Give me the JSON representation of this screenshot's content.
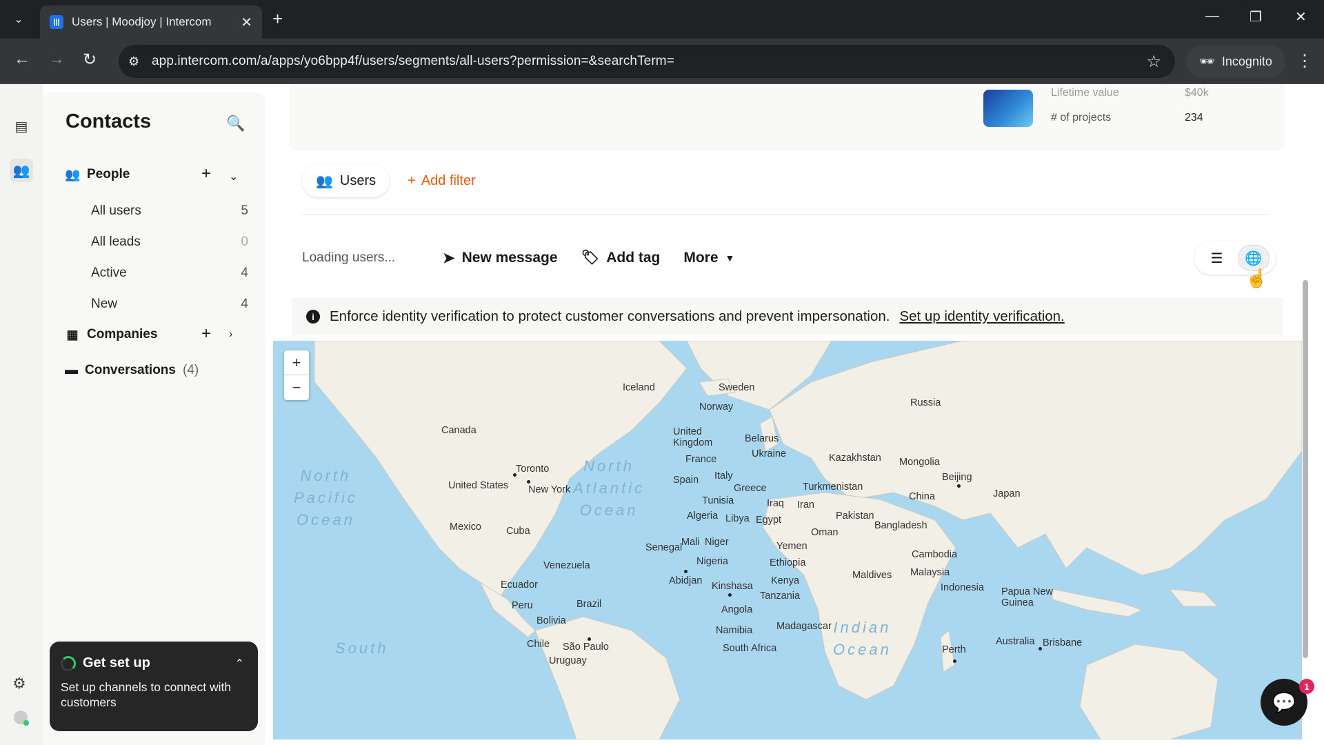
{
  "browser": {
    "tab_title": "Users | Moodjoy | Intercom",
    "url": "app.intercom.com/a/apps/yo6bpp4f/users/segments/all-users?permission=&searchTerm=",
    "incognito_label": "Incognito"
  },
  "sidebar": {
    "title": "Contacts",
    "people_label": "People",
    "items": [
      {
        "label": "All users",
        "count": "5"
      },
      {
        "label": "All leads",
        "count": "0"
      },
      {
        "label": "Active",
        "count": "4"
      },
      {
        "label": "New",
        "count": "4"
      }
    ],
    "companies_label": "Companies",
    "conversations_label": "Conversations",
    "conversations_count": "(4)"
  },
  "setup_card": {
    "title": "Get set up",
    "body": "Set up channels to connect with customers"
  },
  "top_card": {
    "lifetime_label": "Lifetime value",
    "lifetime_value": "$40k",
    "projects_label": "# of projects",
    "projects_value": "234"
  },
  "filters": {
    "users_pill": "Users",
    "add_filter": "Add filter"
  },
  "toolbar": {
    "loading": "Loading users...",
    "new_message": "New message",
    "add_tag": "Add tag",
    "more": "More"
  },
  "notice": {
    "text": "Enforce identity verification to protect customer conversations and prevent impersonation.",
    "link": "Set up identity verification."
  },
  "map": {
    "labels": {
      "iceland": "Iceland",
      "sweden": "Sweden",
      "norway": "Norway",
      "russia": "Russia",
      "canada": "Canada",
      "uk": "United\nKingdom",
      "belarus": "Belarus",
      "ukraine": "Ukraine",
      "kazakhstan": "Kazakhstan",
      "mongolia": "Mongolia",
      "toronto": "Toronto",
      "france": "France",
      "us": "United States",
      "newyork": "New York",
      "spain": "Spain",
      "italy": "Italy",
      "turkmenistan": "Turkmenistan",
      "beijing": "Beijing",
      "greece": "Greece",
      "china": "China",
      "japan": "Japan",
      "tunisia": "Tunisia",
      "iraq": "Iraq",
      "iran": "Iran",
      "pakistan": "Pakistan",
      "algeria": "Algeria",
      "libya": "Libya",
      "egypt": "Egypt",
      "bangladesh": "Bangladesh",
      "mexico": "Mexico",
      "cuba": "Cuba",
      "oman": "Oman",
      "mali": "Mali",
      "niger": "Niger",
      "senegal": "Senegal",
      "yemen": "Yemen",
      "cambodia": "Cambodia",
      "nigeria": "Nigeria",
      "ethiopia": "Ethiopia",
      "venezuela": "Venezuela",
      "malaysia": "Malaysia",
      "abidjan": "Abidjan",
      "maldives": "Maldives",
      "kenya": "Kenya",
      "indonesia": "Indonesia",
      "ecuador": "Ecuador",
      "kinshasa": "Kinshasa",
      "png": "Papua New\nGuinea",
      "tanzania": "Tanzania",
      "brazil": "Brazil",
      "peru": "Peru",
      "angola": "Angola",
      "bolivia": "Bolivia",
      "madagascar": "Madagascar",
      "namibia": "Namibia",
      "australia": "Australia",
      "brisbane": "Brisbane",
      "chile": "Chile",
      "saopaulo": "São Paulo",
      "southafrica": "South Africa",
      "perth": "Perth",
      "uruguay": "Uruguay"
    },
    "oceans": {
      "north_atlantic": "North\nAtlantic\nOcean",
      "north_pacific": "North\nPacific\nOcean",
      "indian": "Indian\nOcean",
      "south": "South"
    }
  },
  "messenger_badge": "1",
  "colors": {
    "accent_orange": "#e8590c",
    "ocean": "#a9d7ef",
    "land": "#f2efe6"
  }
}
